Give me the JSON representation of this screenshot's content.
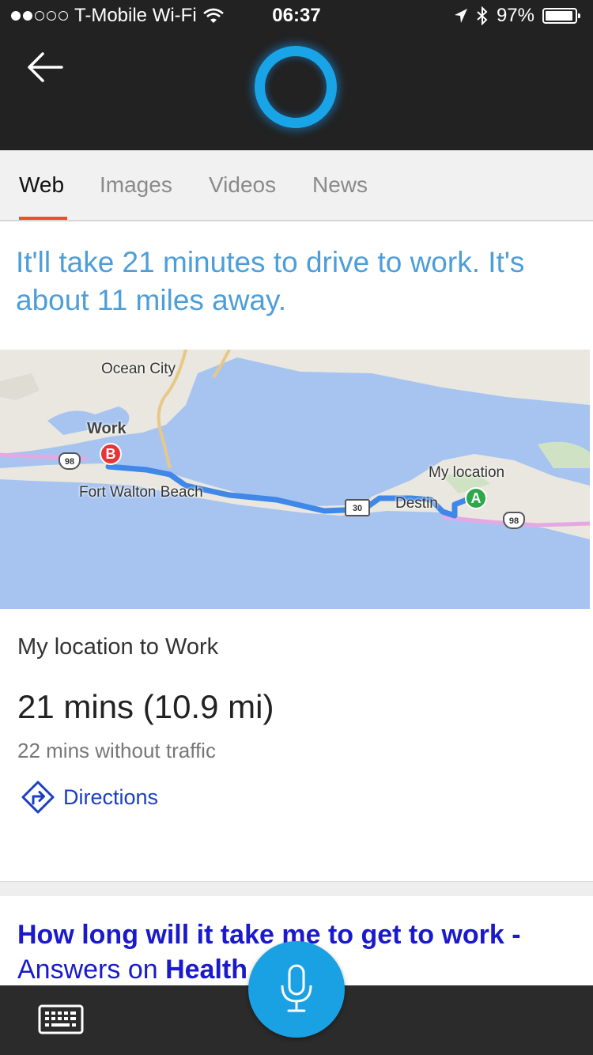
{
  "status_bar": {
    "carrier": "T-Mobile Wi-Fi",
    "time": "06:37",
    "battery": "97%",
    "battery_level": 0.97
  },
  "tabs": [
    {
      "label": "Web",
      "active": true
    },
    {
      "label": "Images",
      "active": false
    },
    {
      "label": "Videos",
      "active": false
    },
    {
      "label": "News",
      "active": false
    }
  ],
  "answer": "It'll take 21 minutes to drive to work. It's about 11 miles away.",
  "map": {
    "labels": {
      "ocean_city": "Ocean City",
      "work": "Work",
      "fort_walton_beach": "Fort Walton Beach",
      "destin": "Destin",
      "my_location": "My location"
    },
    "highway_shields": [
      "98",
      "30",
      "98"
    ],
    "pins": {
      "start": "A",
      "end": "B"
    },
    "colors": {
      "water": "#a7c4f1",
      "land": "#e9e7df",
      "route": "#3f87e8",
      "highway": "#e4a9e3",
      "pin_start": "#2ea84a",
      "pin_end": "#e63535"
    }
  },
  "route": {
    "title": "My location to Work",
    "duration": "21 mins (10.9 mi)",
    "without_traffic": "22 mins without traffic",
    "directions_label": "Directions"
  },
  "result": {
    "line1": "How long will it take me to get to work -",
    "line2_prefix": "Answers on ",
    "line2_bold": "Health"
  },
  "colors": {
    "accent": "#f25022",
    "cortana": "#1aa4e8",
    "link": "#1a1acc",
    "answer_text": "#4d9ed8",
    "header_bg": "#222222"
  }
}
